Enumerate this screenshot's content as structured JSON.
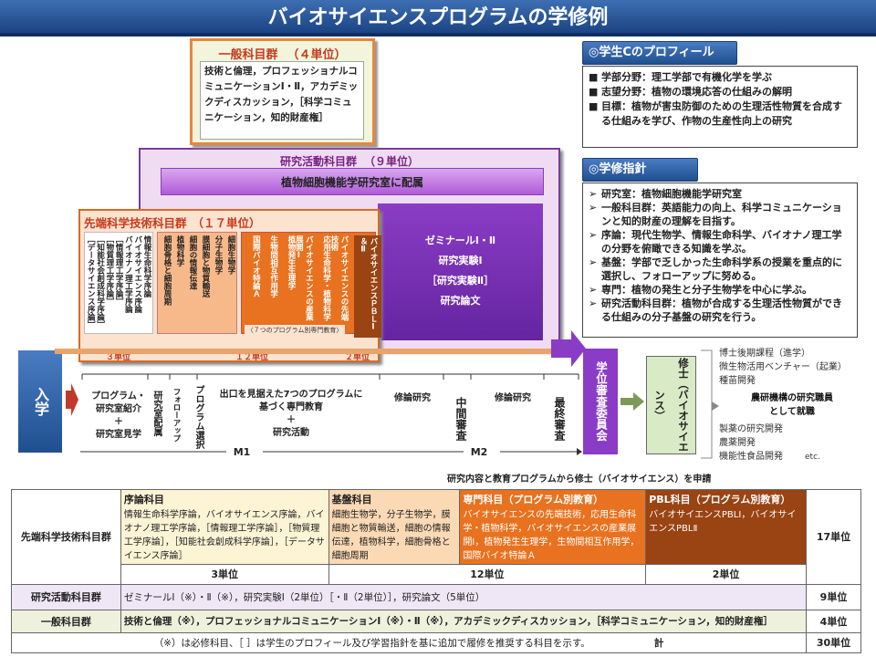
{
  "title": "バイオサイエンスプログラムの学修例",
  "general": {
    "heading": "一般科目群",
    "units": "（４単位）",
    "text": "技術と倫理，プロフェッショナルコミュニケーションⅠ・Ⅱ，アカデミックディスカッション，［科学コミュニケーション，知的財産権］"
  },
  "research": {
    "heading": "研究活動科目群",
    "units": "（９単位）",
    "lab": "植物細胞機能学研究室に配属",
    "seminar_lines": [
      "ゼミナールⅠ・Ⅱ",
      "研究実験Ⅰ",
      "［研究実験Ⅱ］",
      "研究論文"
    ]
  },
  "advanced": {
    "heading": "先端科学技術科目群",
    "units": "（１７単位）",
    "intro_cols": [
      "情報生命科学序論",
      "バイオサイエンス序論",
      "バイオナノ理工学序論",
      "［情報理工学序論］",
      "［物質理工学序論］",
      "［知能社会創成科学序論］",
      "［データサイエンス序論］"
    ],
    "basic_cols": [
      "細胞生物学",
      "分子生物学",
      "膜細胞と物質輸送",
      "細胞の情報伝達",
      "植物科学",
      "細胞骨格と細胞周期"
    ],
    "spec_cols": [
      "バイオサイエンスの先端技術",
      "応用生命科学・植物科学",
      "バイオサイエンスの産業展開Ⅰ",
      "植物発生生理学",
      "生物間相互作用学",
      "国際バイオ特論Ａ"
    ],
    "pbl_col": "バイオサイエンスＰＢＬⅠ＆Ⅱ",
    "spec_note": "〈７つのプログラム別専門教育〉",
    "unit_labels": [
      "３単位",
      "１２単位",
      "２単位"
    ]
  },
  "profile": {
    "heading": "◎学生Cのプロフィール",
    "items": [
      "学部分野：理工学部で有機化学を学ぶ",
      "志望分野：植物の環境応答の仕組みの解明",
      "目標：植物が害虫防御のための生理活性物質を合成する仕組みを学び、作物の生産性向上の研究"
    ]
  },
  "guide": {
    "heading": "◎学修指針",
    "items": [
      "研究室：植物細胞機能学研究室",
      "一般科目群：英語能力の向上、科学コミュニケーションと知的財産の理解を目指す。",
      "序論：現代生物学、情報生命科学、バイオナノ理工学の分野を俯瞰できる知識を学ぶ。",
      "基盤：学部で乏しかった生命科学系の授業を重点的に選択し、フォローアップに努める。",
      "専門：植物の発生と分子生物学を中心に学ぶ。",
      "研究活動科目群：植物が合成する生理活性物質ができる仕組みの分子基盤の研究を行う。"
    ]
  },
  "timeline": {
    "entry": "入学",
    "intro_step": [
      "プログラム・",
      "研究室紹介",
      "＋",
      "研究室見学"
    ],
    "assign": "研究室配属",
    "followup": "フォローアップ",
    "program_select": "プログラム選択",
    "exit_lines": [
      "出口を見据えた7つのプログラムに",
      "基づく専門教育",
      "＋",
      "研究活動"
    ],
    "thesis1": "修論研究",
    "midterm": "中間審査",
    "thesis2": "修論研究",
    "final": "最終審査",
    "m1": "M1",
    "m2": "M2",
    "committee": "学位審査委員会",
    "degree": "修士（バイオサイエンス）",
    "apply": "研究内容と教育プログラムから修士（バイオサイエンス）を申請",
    "careers": [
      "博士後期課程（進学）",
      "微生物活用ベンチャー（起業）",
      "種苗開発"
    ],
    "careers_bold": [
      "農研機構の研究職員",
      "として就職"
    ],
    "careers2": [
      "製薬の研究開発",
      "農薬開発",
      "機能性食品開発"
    ],
    "etc": "etc."
  },
  "table": {
    "row1_label": "先端科学技術科目群",
    "intro_hd": "序論科目",
    "intro_text": "情報生命科学序論，バイオサイエンス序論，バイオナノ理工学序論，［情報理工学序論］，［物質理工学序論］，［知能社会創成科学序論］，［データサイエンス序論］",
    "basic_hd": "基盤科目",
    "basic_text": "細胞生物学，分子生物学，膜細胞と物質輸送，細胞の情報伝達，植物科学，細胞骨格と細胞周期",
    "spec_hd": "専門科目（プログラム別教育）",
    "spec_text": "バイオサイエンスの先端技術，応用生命科学・植物科学，バイオサイエンスの産業展開Ⅰ，植物発生生理学，生物間相互作用学，国際バイオ特論Ａ",
    "pbl_hd": "PBL科目（プログラム別教育）",
    "pbl_text": "バイオサイエンスPBLⅠ，バイオサイエンスPBLⅡ",
    "row1_units": "17単位",
    "sub_units": [
      "3単位",
      "12単位",
      "2単位"
    ],
    "row2_label": "研究活動科目群",
    "row2_text": "ゼミナールⅠ（※）・Ⅱ（※），研究実験Ⅰ（2単位）［・Ⅱ（2単位）］，研究論文（5単位）",
    "row2_units": "9単位",
    "row3_label": "一般科目群",
    "row3_text": "技術と倫理（※），プロフェッショナルコミュニケーションⅠ（※）・Ⅱ（※），アカデミックディスカッション，［科学コミュニケーション，知的財産権］",
    "row3_units": "4単位",
    "footnote": "（※）は必修科目、［ ］は学生のプロフィール及び学習指針を基に追加で履修を推奨する科目を示す。",
    "total_label": "計",
    "total_units": "30単位"
  }
}
